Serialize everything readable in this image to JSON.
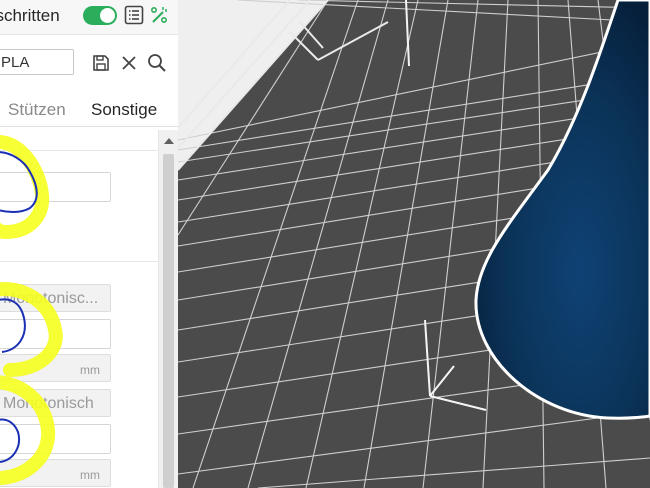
{
  "panel": {
    "advanced_label": "eschritten",
    "advanced_toggle_on": true,
    "profile_value": "PLA",
    "tabs": [
      {
        "label": "Stützen",
        "active": false
      },
      {
        "label": "Sonstige",
        "active": true
      }
    ],
    "fields": {
      "dropdown_1": "Monotonisc...",
      "unit_1": "mm",
      "dropdown_2": "Monotonisch",
      "unit_2": "mm"
    }
  },
  "colors": {
    "toggle": "#2aae5b",
    "bed": "#4b4b4b",
    "grid_line": "#cfcfcf",
    "model": "#0b3358",
    "highlight": "#f6ff1f",
    "scribble": "#1a2fb4"
  },
  "icons": [
    "list-icon",
    "wand-icon",
    "save-icon",
    "close-icon",
    "search-icon",
    "chevron-up-icon"
  ]
}
